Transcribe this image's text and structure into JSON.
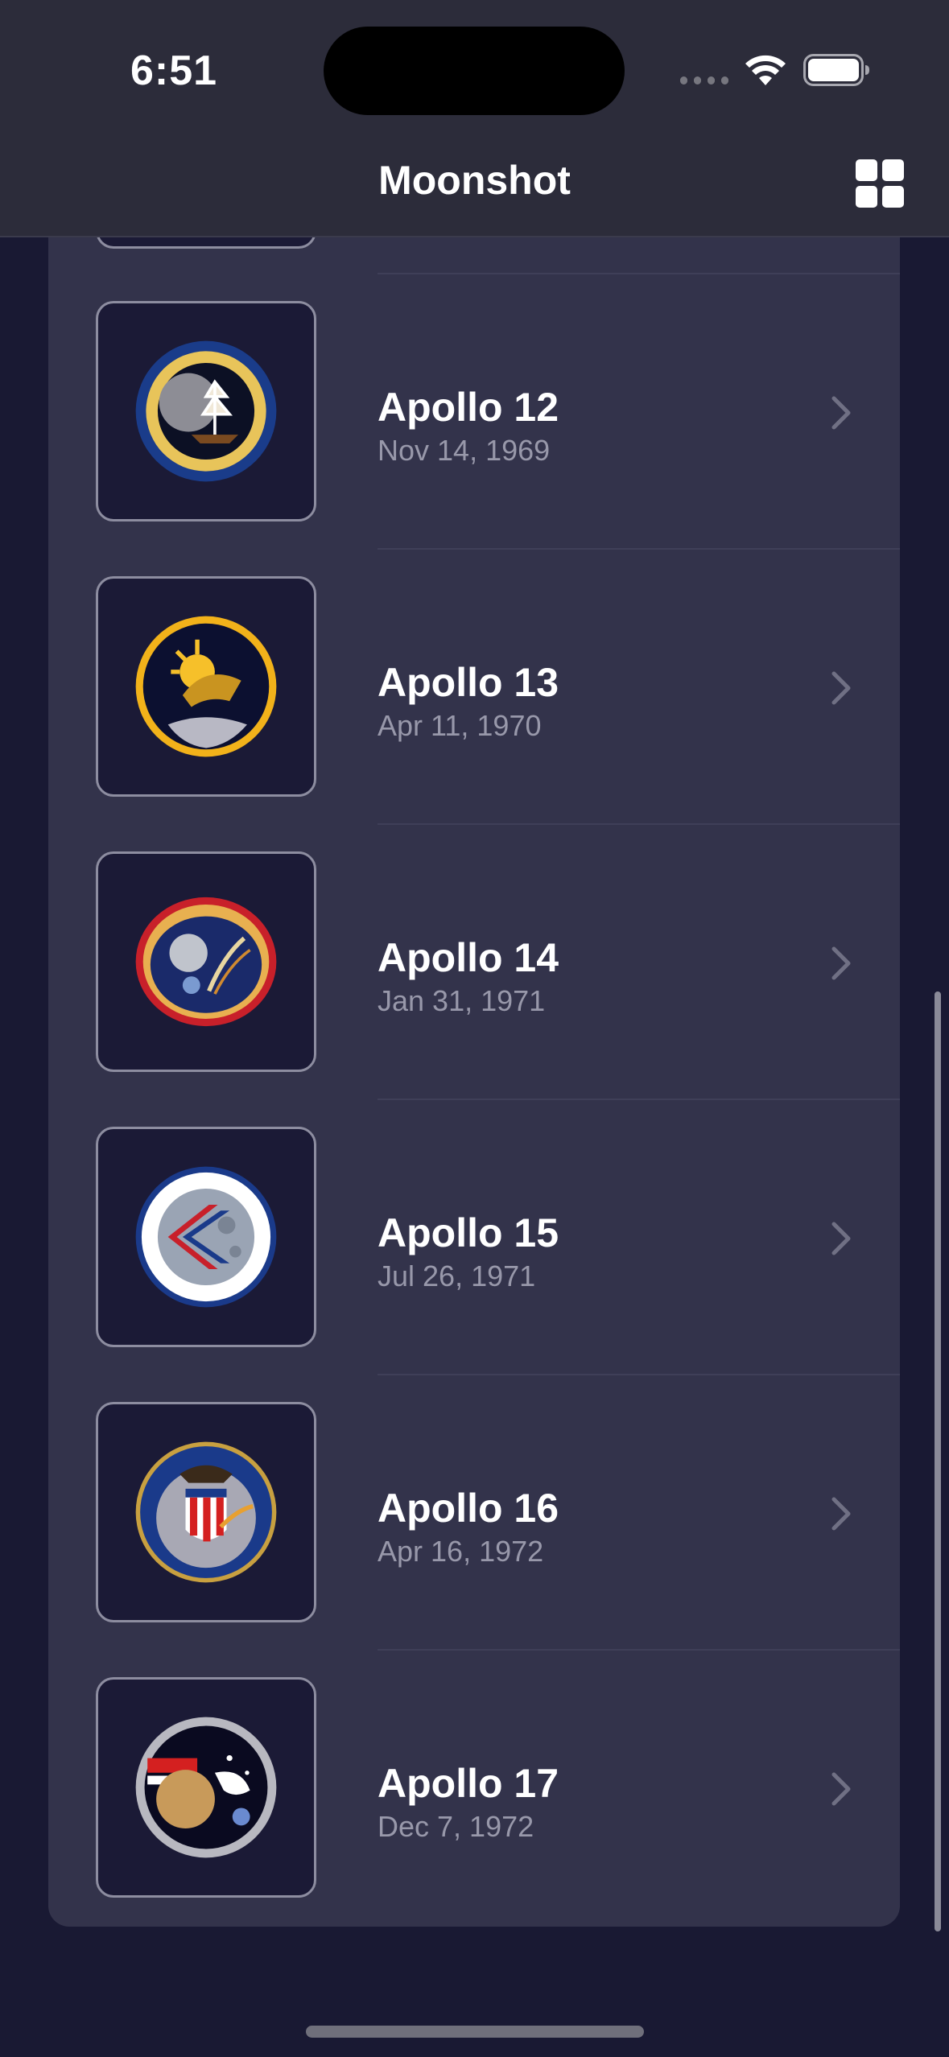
{
  "status_bar": {
    "time": "6:51"
  },
  "nav": {
    "title": "Moonshot",
    "layout_toggle_icon": "grid-icon"
  },
  "missions": [
    {
      "name": "Apollo 12",
      "date": "Nov 14, 1969",
      "badge_colors": [
        "#1a3c8a",
        "#e8c45a",
        "#6a6a70"
      ]
    },
    {
      "name": "Apollo 13",
      "date": "Apr 11, 1970",
      "badge_colors": [
        "#0c1030",
        "#f2b21a",
        "#c99420"
      ]
    },
    {
      "name": "Apollo 14",
      "date": "Jan 31, 1971",
      "badge_colors": [
        "#c8202a",
        "#1a2a6a",
        "#e8d6a0"
      ]
    },
    {
      "name": "Apollo 15",
      "date": "Jul 26, 1971",
      "badge_colors": [
        "#1a3a8a",
        "#ffffff",
        "#c8202a"
      ]
    },
    {
      "name": "Apollo 16",
      "date": "Apr 16, 1972",
      "badge_colors": [
        "#1a3a8a",
        "#d42020",
        "#c8a040"
      ]
    },
    {
      "name": "Apollo 17",
      "date": "Dec 7, 1972",
      "badge_colors": [
        "#0a0a20",
        "#c89a5a",
        "#b8b8c0"
      ]
    }
  ],
  "colors": {
    "background": "#191933",
    "card": "#33334b",
    "secondary_text": "#9898aa"
  }
}
